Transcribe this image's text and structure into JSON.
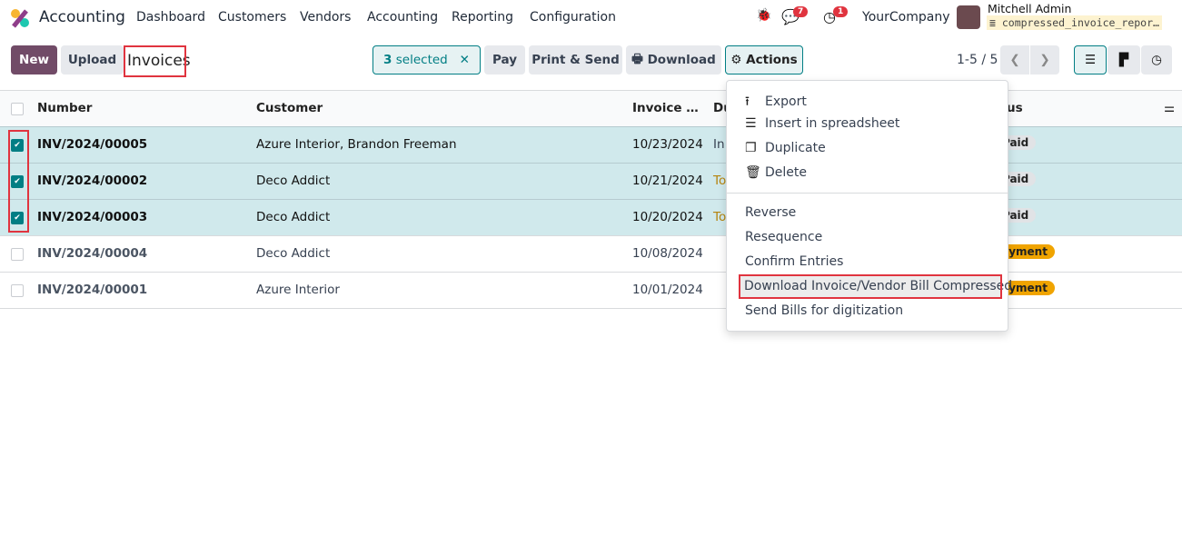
{
  "nav": {
    "app": "Accounting",
    "menus": [
      "Dashboard",
      "Customers",
      "Vendors",
      "Accounting",
      "Reporting",
      "Configuration"
    ],
    "messages_count": "7",
    "activities_count": "1",
    "company": "YourCompany",
    "user": "Mitchell Admin",
    "database": "compressed_invoice_repor…"
  },
  "toolbar": {
    "new": "New",
    "upload": "Upload",
    "title": "Invoices",
    "selected_count": "3",
    "selected_label": "selected",
    "pay": "Pay",
    "print_send": "Print & Send",
    "download": "Download",
    "actions": "Actions",
    "pager": "1-5 / 5"
  },
  "table": {
    "headers": [
      "Number",
      "Customer",
      "Invoice …",
      "Du",
      "us"
    ],
    "rows": [
      {
        "selected": true,
        "number": "INV/2024/00005",
        "customer": "Azure Interior, Brandon Freeman",
        "date": "10/23/2024",
        "due": "In",
        "due_color": "#374151",
        "status": ": Paid",
        "status_color": "#e1e3e6"
      },
      {
        "selected": true,
        "number": "INV/2024/00002",
        "customer": "Deco Addict",
        "date": "10/21/2024",
        "due": "To",
        "due_color": "#b5840e",
        "status": ": Paid",
        "status_color": "#e1e3e6"
      },
      {
        "selected": true,
        "number": "INV/2024/00003",
        "customer": "Deco Addict",
        "date": "10/20/2024",
        "due": "To",
        "due_color": "#b5840e",
        "status": ": Paid",
        "status_color": "#e1e3e6"
      },
      {
        "selected": false,
        "number": "INV/2024/00004",
        "customer": "Deco Addict",
        "date": "10/08/2024",
        "due": "",
        "due_color": "#374151",
        "status": "Payment",
        "status_color": "#f0a400"
      },
      {
        "selected": false,
        "number": "INV/2024/00001",
        "customer": "Azure Interior",
        "date": "10/01/2024",
        "due": "",
        "due_color": "#374151",
        "status": "Payment",
        "status_color": "#f0a400"
      }
    ]
  },
  "actions_menu": {
    "group1": [
      {
        "label": "Export",
        "icon": "upload-icon"
      },
      {
        "label": "Insert in spreadsheet",
        "icon": "list-icon"
      },
      {
        "label": "Duplicate",
        "icon": "copy-icon"
      },
      {
        "label": "Delete",
        "icon": "trash-icon"
      }
    ],
    "group2": [
      "Reverse",
      "Resequence",
      "Confirm Entries",
      "Download Invoice/Vendor Bill Compressed",
      "Send Bills for digitization"
    ]
  },
  "colors": {
    "brand": "#714b67",
    "accent": "#017e84",
    "highlight": "#e0343f"
  }
}
